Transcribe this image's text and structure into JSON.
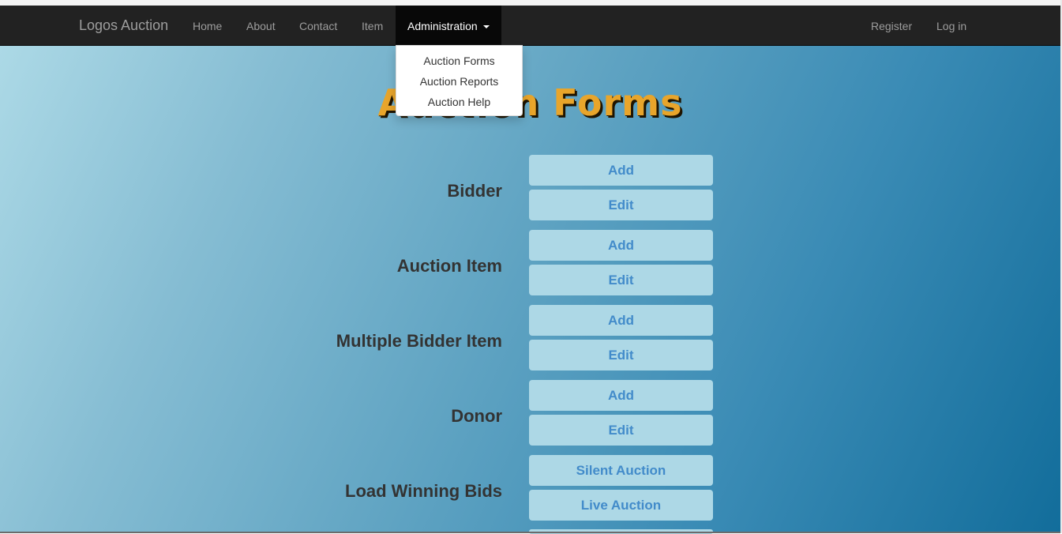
{
  "navbar": {
    "brand": "Logos Auction",
    "links": [
      "Home",
      "About",
      "Contact",
      "Item"
    ],
    "active": "Administration",
    "right": [
      "Register",
      "Log in"
    ]
  },
  "dropdown": {
    "items": [
      "Auction Forms",
      "Auction Reports",
      "Auction Help"
    ]
  },
  "page": {
    "title": "Auction Forms"
  },
  "sections": [
    {
      "label": "Bidder",
      "buttons": [
        "Add",
        "Edit"
      ]
    },
    {
      "label": "Auction Item",
      "buttons": [
        "Add",
        "Edit"
      ]
    },
    {
      "label": "Multiple Bidder Item",
      "buttons": [
        "Add",
        "Edit"
      ]
    },
    {
      "label": "Donor",
      "buttons": [
        "Add",
        "Edit"
      ]
    },
    {
      "label": "Load Winning Bids",
      "buttons": [
        "Silent Auction",
        "Live Auction"
      ]
    }
  ],
  "colors": {
    "navbar": "#222222",
    "title": "#e8a52b",
    "button_bg": "#add8e6",
    "button_text": "#428bca"
  }
}
